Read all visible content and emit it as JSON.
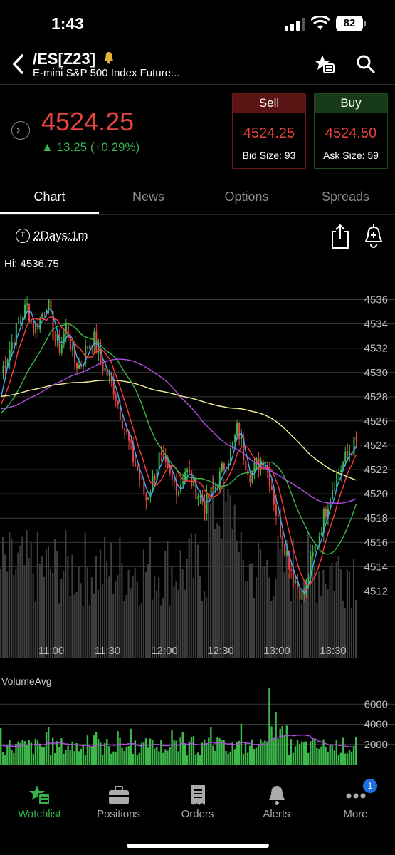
{
  "status": {
    "time": "1:43",
    "battery": "82"
  },
  "header": {
    "symbol": "/ES[Z23]",
    "description": "E-mini S&P 500 Index Future..."
  },
  "quote": {
    "last": "4524.25",
    "change": "▲ 13.25 (+0.29%)",
    "sell": {
      "label": "Sell",
      "price": "4524.25",
      "size": "Bid Size: 93"
    },
    "buy": {
      "label": "Buy",
      "price": "4524.50",
      "size": "Ask Size: 59"
    }
  },
  "tabs": [
    {
      "label": "Chart",
      "active": true
    },
    {
      "label": "News",
      "active": false
    },
    {
      "label": "Options",
      "active": false
    },
    {
      "label": "Spreads",
      "active": false
    }
  ],
  "chart_toolbar": {
    "range_icon": "T",
    "range": "2Days:1m",
    "hi": "Hi: 4536.75"
  },
  "chart_data": [
    {
      "type": "candlestick",
      "y_ticks": [
        "4536",
        "4534",
        "4532",
        "4530",
        "4528",
        "4526",
        "4524",
        "4522",
        "4520",
        "4518",
        "4516",
        "4514",
        "4512"
      ],
      "x_ticks": [
        "11:00",
        "11:30",
        "12:00",
        "12:30",
        "13:00",
        "13:30"
      ],
      "ylim": [
        4510.5,
        4537.5
      ],
      "close_path": [
        4530,
        4531.5,
        4533,
        4534.5,
        4535.5,
        4533.5,
        4534.5,
        4536,
        4533,
        4532,
        4534,
        4531,
        4530.5,
        4532,
        4533,
        4531,
        4530,
        4529,
        4527,
        4525,
        4523,
        4521.5,
        4519.5,
        4521,
        4523,
        4522,
        4521,
        4520.5,
        4522,
        4521,
        4520,
        4519,
        4520,
        4521,
        4522.5,
        4523.5,
        4525.5,
        4523,
        4521.5,
        4522.5,
        4523,
        4521,
        4518,
        4516,
        4514,
        4512.5,
        4511.5,
        4514,
        4516,
        4518,
        4520,
        4521.5,
        4522.5,
        4523.5,
        4524.25
      ],
      "series": [
        {
          "name": "fast_ma",
          "color": "#4aa3ff"
        },
        {
          "name": "mid_ma",
          "color": "#ff3b3b"
        },
        {
          "name": "slow_ma",
          "color": "#3db84a"
        },
        {
          "name": "long_ma",
          "color": "#b04fe0"
        },
        {
          "name": "longest_ma",
          "color": "#f7f19a"
        }
      ]
    },
    {
      "type": "bar",
      "title": "VolumeAvg",
      "y_ticks": [
        "6000",
        "4000",
        "2000"
      ],
      "ylim": [
        0,
        8000
      ],
      "bar_color": "#3db84a",
      "avg_color": "#b04fe0"
    }
  ],
  "nav": [
    {
      "label": "Watchlist",
      "icon": "watchlist-icon",
      "active": true
    },
    {
      "label": "Positions",
      "icon": "briefcase-icon",
      "active": false
    },
    {
      "label": "Orders",
      "icon": "receipt-icon",
      "active": false
    },
    {
      "label": "Alerts",
      "icon": "bell-icon",
      "active": false
    },
    {
      "label": "More",
      "icon": "more-icon",
      "active": false,
      "badge": "1"
    }
  ]
}
